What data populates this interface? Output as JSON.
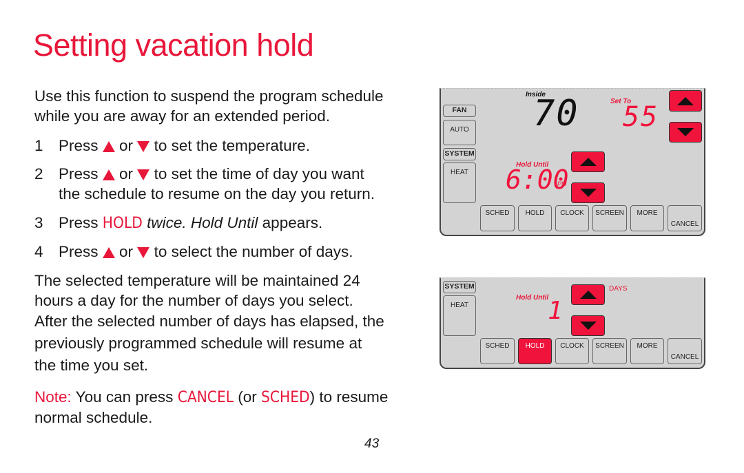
{
  "title": "Setting vacation hold",
  "intro": [
    "Use this function to suspend the program schedule",
    "while you are away for an extended period."
  ],
  "steps": [
    {
      "num": "1",
      "pre": "Press",
      "or": "or",
      "post": "to set the temperature."
    },
    {
      "num": "2",
      "pre": "Press",
      "or": "or",
      "post": "to set the time of day you want",
      "line2": "the schedule to resume on the day you return."
    },
    {
      "num": "3",
      "pre": "Press",
      "kw": "HOLD",
      "it1": "twice.",
      "it2": "Hold Until",
      "post": "appears."
    },
    {
      "num": "4",
      "pre": "Press",
      "or": "or",
      "post": "to select the number of days."
    }
  ],
  "paragraph": [
    "The selected temperature will be maintained 24",
    "hours a day for the number of days you select.",
    "After the selected number of days has elapsed, the",
    "previously programmed schedule will resume at",
    "the time you set."
  ],
  "note": {
    "label": "Note:",
    "text1": "You can press",
    "kw1": "CANCEL",
    "text2": "(or",
    "kw2": "SCHED",
    "text3": ") to resume",
    "line2": "normal schedule."
  },
  "page_number": "43",
  "display1": {
    "fan_label": "FAN",
    "fan_value": "AUTO",
    "system_label": "SYSTEM",
    "system_value": "HEAT",
    "inside_label": "Inside",
    "inside_temp": "70",
    "setto_label": "Set To",
    "setto_temp": "55",
    "hold_label": "Hold Until",
    "hold_time": "6:00",
    "hold_ampm": "PM",
    "buttons": [
      "SCHED",
      "HOLD",
      "CLOCK",
      "SCREEN",
      "MORE",
      "CANCEL"
    ]
  },
  "display2": {
    "system_label": "SYSTEM",
    "system_value": "HEAT",
    "hold_label": "Hold Until",
    "days_value": "1",
    "days_label": "DAYS",
    "buttons": [
      "SCHED",
      "HOLD",
      "CLOCK",
      "SCREEN",
      "MORE",
      "CANCEL"
    ],
    "active_button": "HOLD"
  },
  "colors": {
    "accent": "#e8173a",
    "display_bg": "#d3d3d3",
    "arrow_button": "#f0143c"
  }
}
